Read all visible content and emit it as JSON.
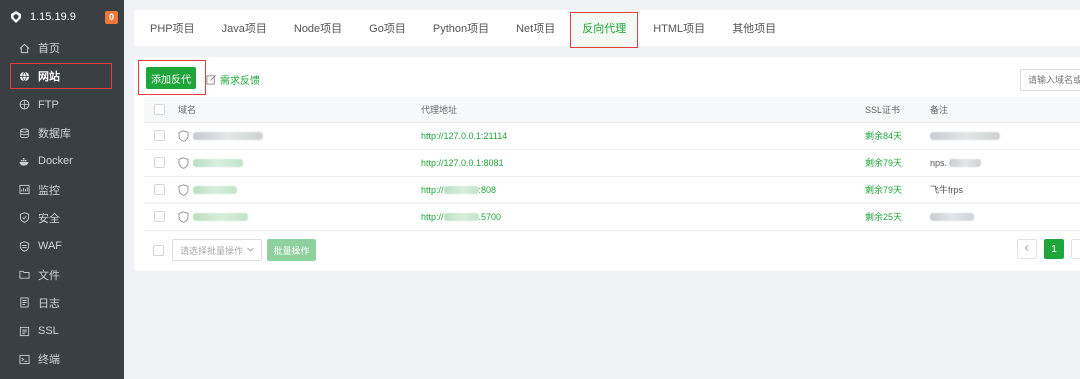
{
  "sidebar": {
    "version": "1.15.19.9",
    "badge_count": "0",
    "items": [
      {
        "label": "首页",
        "icon": "home-icon"
      },
      {
        "label": "网站",
        "icon": "globe-icon",
        "active": true
      },
      {
        "label": "FTP",
        "icon": "ftp-icon"
      },
      {
        "label": "数据库",
        "icon": "database-icon"
      },
      {
        "label": "Docker",
        "icon": "docker-icon"
      },
      {
        "label": "监控",
        "icon": "monitor-icon"
      },
      {
        "label": "安全",
        "icon": "shield-icon"
      },
      {
        "label": "WAF",
        "icon": "waf-icon"
      },
      {
        "label": "文件",
        "icon": "folder-icon"
      },
      {
        "label": "日志",
        "icon": "log-icon"
      },
      {
        "label": "SSL",
        "icon": "ssl-icon"
      },
      {
        "label": "终端",
        "icon": "terminal-icon"
      }
    ]
  },
  "tabs": [
    {
      "label": "PHP项目"
    },
    {
      "label": "Java项目"
    },
    {
      "label": "Node项目"
    },
    {
      "label": "Go项目"
    },
    {
      "label": "Python项目"
    },
    {
      "label": "Net项目"
    },
    {
      "label": "反向代理",
      "active": true
    },
    {
      "label": "HTML项目"
    },
    {
      "label": "其他项目"
    }
  ],
  "toolbar": {
    "add_label": "添加反代",
    "feedback_label": "需求反馈",
    "search_placeholder": "请输入域名或备注"
  },
  "table": {
    "headers": {
      "domain": "域名",
      "proxy": "代理地址",
      "ssl": "SSL证书",
      "remark": "备注"
    },
    "rows": [
      {
        "proxy_prefix": "http://127.0.0.1:21114",
        "proxy_suffix": "",
        "ssl": "剩余84天",
        "remark": ""
      },
      {
        "proxy_prefix": "http://127.0.0.1:8081",
        "proxy_suffix": "",
        "ssl": "剩余79天",
        "remark": "nps."
      },
      {
        "proxy_prefix": "http://",
        "proxy_suffix": ":808",
        "ssl": "剩余79天",
        "remark": "飞牛frps"
      },
      {
        "proxy_prefix": "http://",
        "proxy_suffix": ".5700",
        "ssl": "剩余25天",
        "remark": ""
      }
    ]
  },
  "footer": {
    "batch_placeholder": "请选择批量操作",
    "batch_button": "批量操作",
    "current_page": "1"
  },
  "colors": {
    "accent": "#20a53a",
    "sidebar_bg": "#3a3f44",
    "highlight": "#e23c3c",
    "badge": "#f0793a"
  }
}
